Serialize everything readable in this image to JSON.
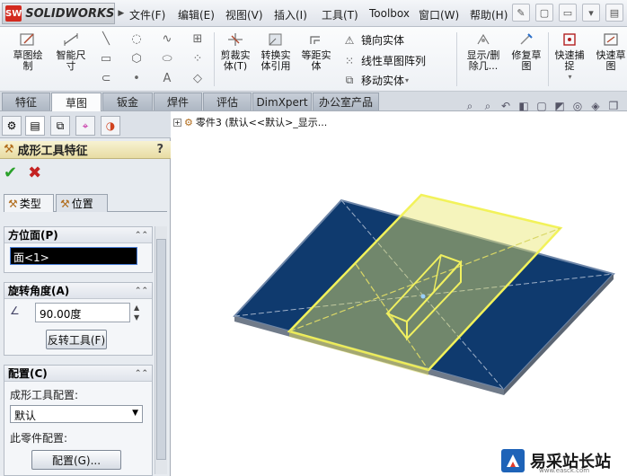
{
  "app": {
    "logo_text": "SOLIDWORKS",
    "brand_color": "#d32a1f"
  },
  "menu": [
    {
      "label": "文件(F)"
    },
    {
      "label": "编辑(E)"
    },
    {
      "label": "视图(V)"
    },
    {
      "label": "插入(I)"
    },
    {
      "label": "工具(T)"
    },
    {
      "label": "Toolbox"
    },
    {
      "label": "窗口(W)"
    },
    {
      "label": "帮助(H)"
    }
  ],
  "commands": {
    "sketch": "草图绘\n制",
    "smart_dim": "智能尺\n寸",
    "trim": "剪裁实\n体(T)",
    "convert": "转换实\n体引用",
    "offset": "等距实\n体",
    "mirror": "镜向实体",
    "linear_pattern": "线性草图阵列",
    "move": "移动实体",
    "display_delete": "显示/删\n除几...",
    "repair": "修复草\n图",
    "quick_snap": "快速捕\n捉",
    "quick_sketch": "快速草\n图"
  },
  "tabs": [
    {
      "label": "特征"
    },
    {
      "label": "草图"
    },
    {
      "label": "钣金"
    },
    {
      "label": "焊件"
    },
    {
      "label": "评估"
    },
    {
      "label": "DimXpert"
    },
    {
      "label": "办公室产品"
    }
  ],
  "property_manager": {
    "title": "成形工具特征",
    "help": "?",
    "subtabs": [
      {
        "label": "类型"
      },
      {
        "label": "位置"
      }
    ],
    "face_group": {
      "title": "方位面(P)",
      "value": "面<1>"
    },
    "rotation_group": {
      "title": "旋转角度(A)",
      "angle": "90.00度",
      "reverse_button": "反转工具(F)"
    },
    "config_group": {
      "title": "配置(C)",
      "tool_config_label": "成形工具配置:",
      "tool_config_value": "默认",
      "part_config_label": "此零件配置:",
      "config_button": "配置(G)..."
    }
  },
  "graphics": {
    "tree_text": "零件3 (默认<<默认>_显示...",
    "plate_color": "#0f3a6e",
    "tool_color": "#e8e66a"
  },
  "watermark": {
    "text": "易采站长站",
    "url": "www.easck.com"
  }
}
